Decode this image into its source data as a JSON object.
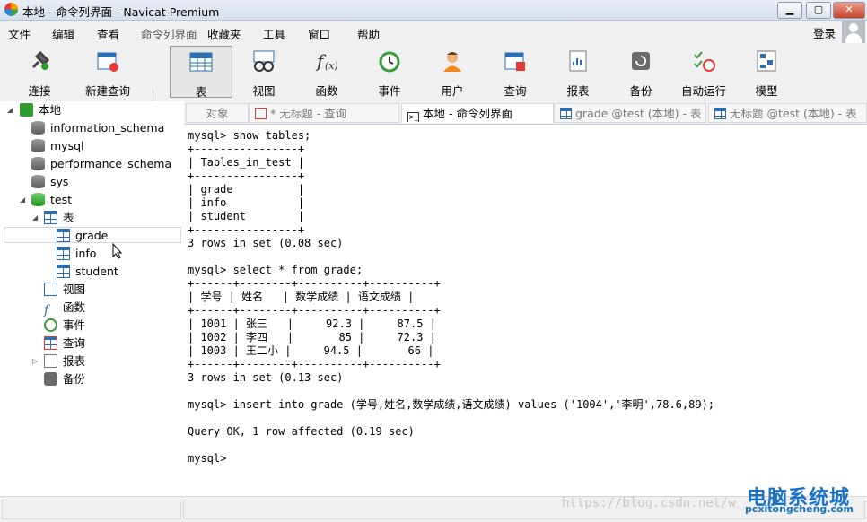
{
  "window": {
    "title": "本地 - 命令列界面 - Navicat Premium",
    "min": "▁",
    "max": "▢",
    "close": "✕"
  },
  "menu": [
    "文件",
    "编辑",
    "查看",
    "命令列界面",
    "收藏夹",
    "工具",
    "窗口",
    "帮助"
  ],
  "login": "登录",
  "toolbar": [
    {
      "label": "连接",
      "icon": "plug-icon"
    },
    {
      "label": "新建查询",
      "icon": "new-query-icon"
    },
    {
      "label": "表",
      "icon": "table-icon",
      "active": true
    },
    {
      "label": "视图",
      "icon": "view-icon"
    },
    {
      "label": "函数",
      "icon": "function-icon"
    },
    {
      "label": "事件",
      "icon": "clock-icon"
    },
    {
      "label": "用户",
      "icon": "user-icon"
    },
    {
      "label": "查询",
      "icon": "query-icon"
    },
    {
      "label": "报表",
      "icon": "report-icon"
    },
    {
      "label": "备份",
      "icon": "backup-icon"
    },
    {
      "label": "自动运行",
      "icon": "schedule-icon"
    },
    {
      "label": "模型",
      "icon": "model-icon"
    }
  ],
  "tree": {
    "root": "本地",
    "dbs": [
      "information_schema",
      "mysql",
      "performance_schema",
      "sys",
      "test"
    ],
    "group": "表",
    "tables": [
      "grade",
      "info",
      "student"
    ],
    "others": [
      "视图",
      "函数",
      "事件",
      "查询",
      "报表",
      "备份"
    ]
  },
  "tabs": [
    "对象",
    "* 无标题 - 查询",
    "本地 - 命令列界面",
    "grade @test (本地) - 表",
    "无标题 @test (本地) - 表"
  ],
  "console": [
    "mysql> show tables;",
    "+----------------+",
    "| Tables_in_test |",
    "+----------------+",
    "| grade          |",
    "| info           |",
    "| student        |",
    "+----------------+",
    "3 rows in set (0.08 sec)",
    "",
    "mysql> select * from grade;",
    "+------+--------+----------+----------+",
    "| 学号 | 姓名   | 数学成绩 | 语文成绩 |",
    "+------+--------+----------+----------+",
    "| 1001 | 张三   |     92.3 |     87.5 |",
    "| 1002 | 李四   |       85 |     72.3 |",
    "| 1003 | 王二小 |     94.5 |       66 |",
    "+------+--------+----------+----------+",
    "3 rows in set (0.13 sec)",
    "",
    "mysql> insert into grade (学号,姓名,数学成绩,语文成绩) values ('1004','李明',78.6,89);",
    "",
    "Query OK, 1 row affected (0.19 sec)",
    "",
    "mysql>"
  ],
  "watermark": "https://blog.csdn.net/w",
  "brand": {
    "main": "电脑系统城",
    "sub": "pcxitongcheng.com"
  }
}
